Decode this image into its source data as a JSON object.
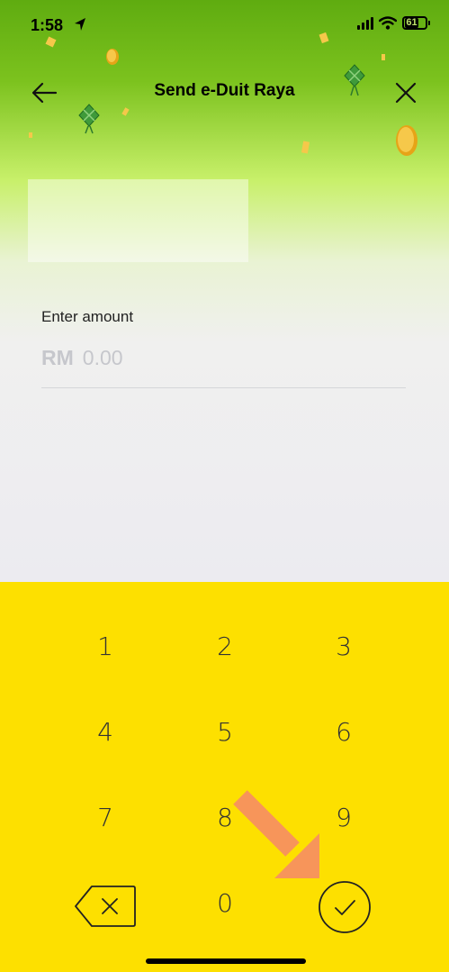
{
  "status_bar": {
    "time": "1:58",
    "battery": "61"
  },
  "header": {
    "title": "Send e-Duit Raya"
  },
  "amount": {
    "label": "Enter amount",
    "currency": "RM",
    "placeholder_value": "0.00"
  },
  "keypad": {
    "keys": [
      "1",
      "2",
      "3",
      "4",
      "5",
      "6",
      "7",
      "8",
      "9",
      "0"
    ]
  },
  "colors": {
    "keypad_background": "#fde000",
    "header_green": "#6bb516",
    "annotation_arrow": "#f7955a"
  },
  "icons": [
    "location-arrow-icon",
    "signal-icon",
    "wifi-icon",
    "battery-icon",
    "back-arrow-icon",
    "close-icon",
    "backspace-icon",
    "check-icon"
  ]
}
